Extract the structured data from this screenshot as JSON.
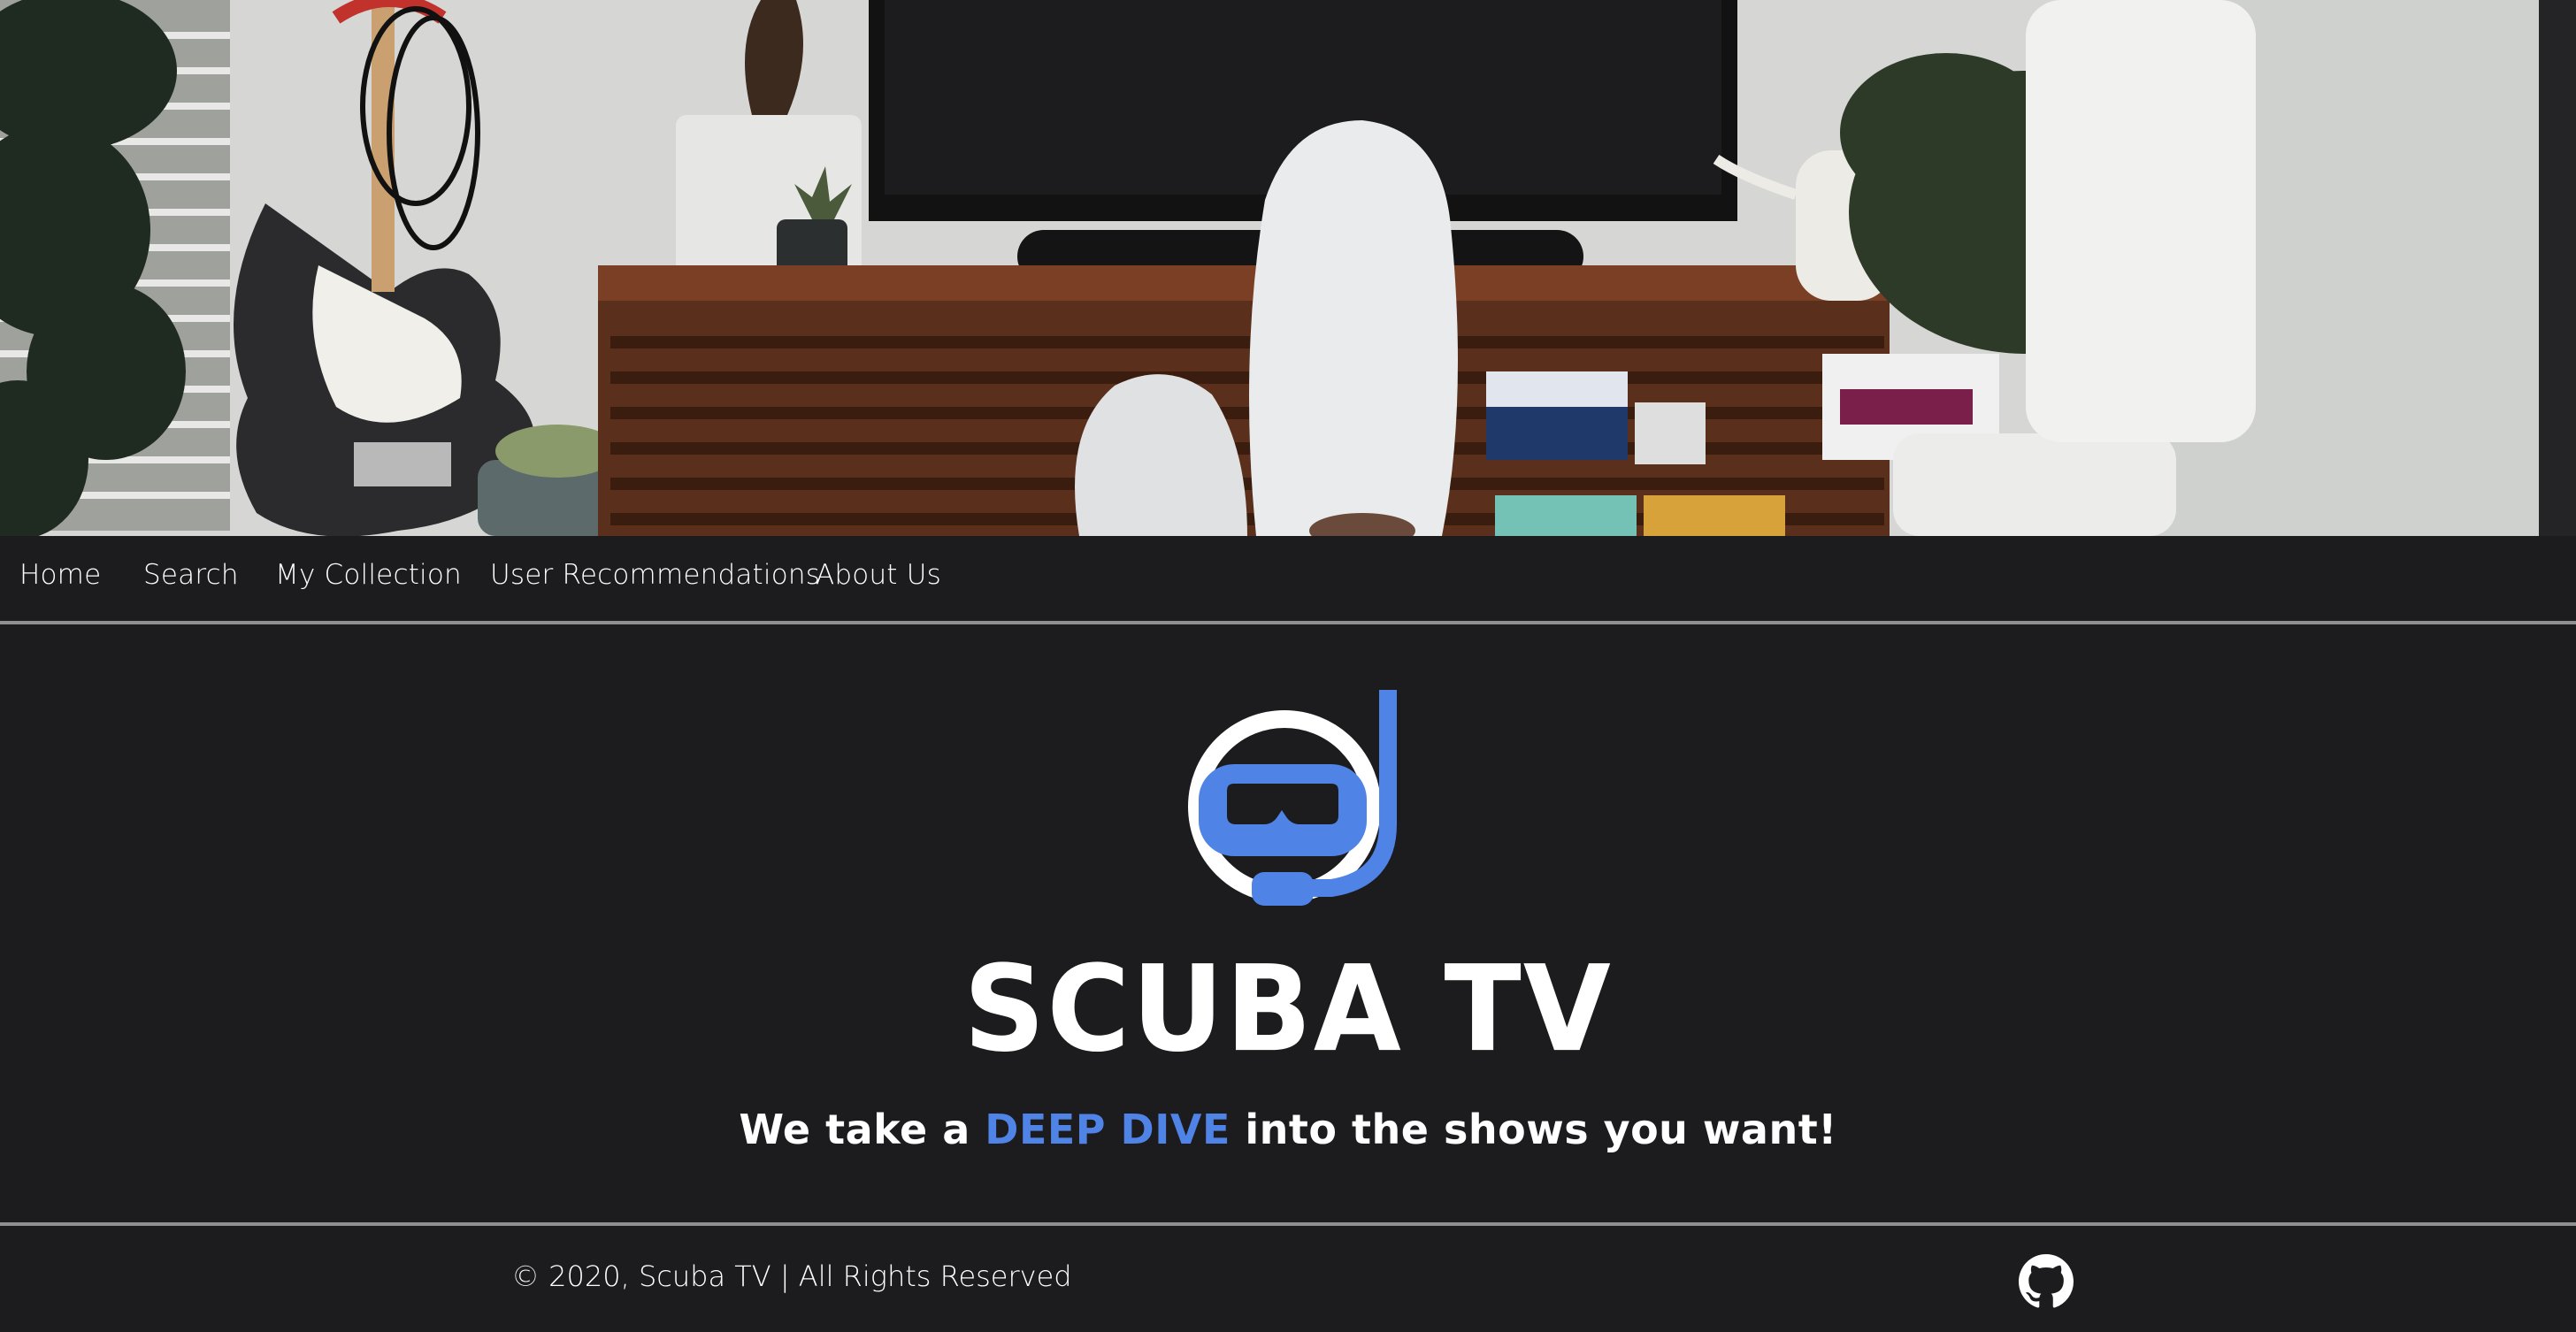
{
  "nav": {
    "items": [
      {
        "label": "Home"
      },
      {
        "label": "Search"
      },
      {
        "label": "My Collection"
      },
      {
        "label": "User Recommendations"
      },
      {
        "label": "About Us"
      }
    ]
  },
  "hero": {
    "description": "Living room with feet in white socks propped up in front of a TV on a wooden media console, guitar and plants"
  },
  "brand": {
    "title": "SCUBA TV",
    "tagline_before": "We take a ",
    "tagline_accent": "DEEP DIVE",
    "tagline_after": " into the shows you want!",
    "logo_icon": "snorkel-mask-icon"
  },
  "footer": {
    "copyright": "© 2020, Scuba TV | All Rights Reserved",
    "github_icon": "github-icon"
  },
  "colors": {
    "background": "#1c1b1d",
    "accent": "#4f83e6",
    "divider": "#8f8f91",
    "text": "#ffffff"
  }
}
